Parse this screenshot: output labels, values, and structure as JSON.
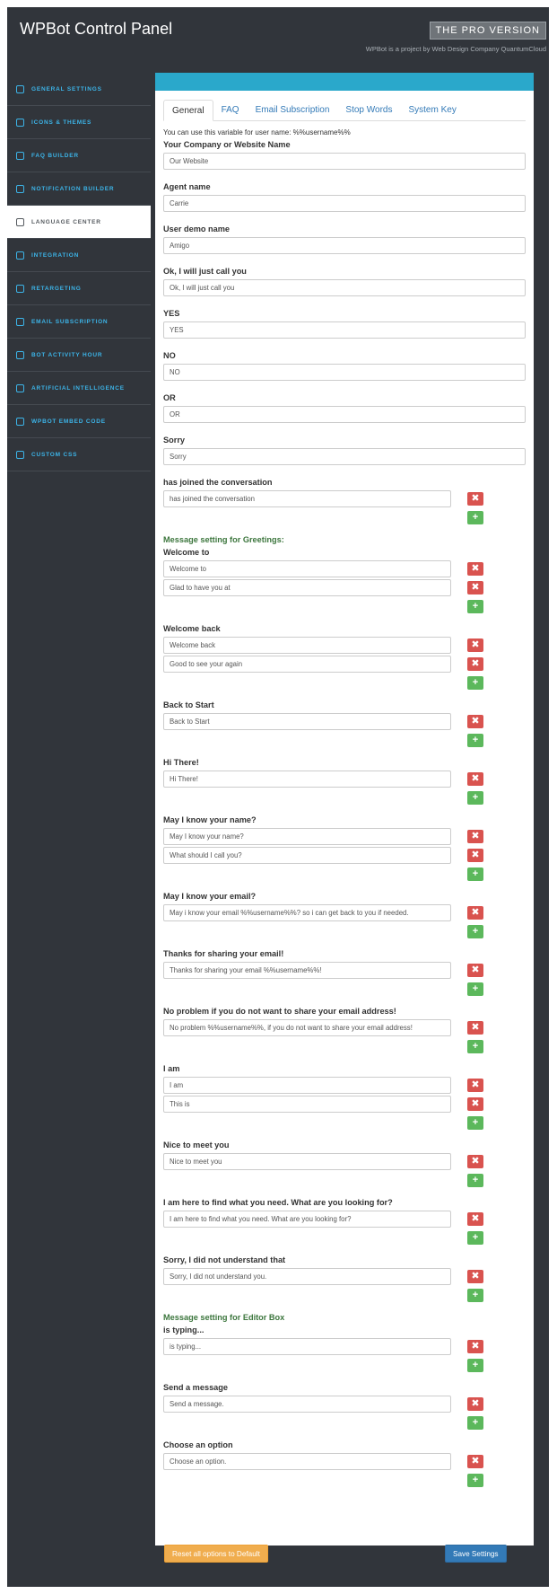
{
  "header": {
    "title": "WPBot Control Panel",
    "pro_badge": "THE PRO VERSION",
    "subtitle": "WPBot is a project by Web Design Company QuantumCloud"
  },
  "sidebar": {
    "items": [
      {
        "label": "GENERAL SETTINGS",
        "icon": "toggle-icon"
      },
      {
        "label": "ICONS & THEMES",
        "icon": "gear-icon"
      },
      {
        "label": "FAQ BUILDER",
        "icon": "lifebuoy-icon"
      },
      {
        "label": "NOTIFICATION BUILDER",
        "icon": "bell-icon"
      },
      {
        "label": "LANGUAGE CENTER",
        "icon": "translate-icon",
        "active": true
      },
      {
        "label": "INTEGRATION",
        "icon": "share-icon"
      },
      {
        "label": "RETARGETING",
        "icon": "retweet-icon"
      },
      {
        "label": "EMAIL SUBSCRIPTION",
        "icon": "envelope-icon"
      },
      {
        "label": "BOT ACTIVITY HOUR",
        "icon": "calendar-icon"
      },
      {
        "label": "ARTIFICIAL INTELLIGENCE",
        "icon": "database-icon"
      },
      {
        "label": "WPBOT EMBED CODE",
        "icon": "mobile-icon"
      },
      {
        "label": "CUSTOM CSS",
        "icon": "code-icon"
      }
    ]
  },
  "tabs": [
    "General",
    "FAQ",
    "Email Subscription",
    "Stop Words",
    "System Key"
  ],
  "note": "You can use this variable for user name: %%username%%",
  "sections": {
    "greetings": "Message setting for Greetings:",
    "editor": "Message setting for Editor Box"
  },
  "fields": [
    {
      "label": "Your Company or Website Name",
      "values": [
        "Our Website"
      ]
    },
    {
      "label": "Agent name",
      "values": [
        "Carrie"
      ]
    },
    {
      "label": "User demo name",
      "values": [
        "Amigo"
      ]
    },
    {
      "label": "Ok, I will just call you",
      "values": [
        "Ok, I will just call you"
      ]
    },
    {
      "label": "YES",
      "values": [
        "YES"
      ]
    },
    {
      "label": "NO",
      "values": [
        "NO"
      ]
    },
    {
      "label": "OR",
      "values": [
        "OR"
      ]
    },
    {
      "label": "Sorry",
      "values": [
        "Sorry"
      ]
    },
    {
      "label": "has joined the conversation",
      "values": [
        "has joined the conversation"
      ]
    },
    {
      "label": "Welcome to",
      "values": [
        "Welcome to",
        "Glad to have you at"
      ]
    },
    {
      "label": "Welcome back",
      "values": [
        "Welcome back",
        "Good to see your again"
      ]
    },
    {
      "label": "Back to Start",
      "values": [
        "Back to Start"
      ]
    },
    {
      "label": "Hi There!",
      "values": [
        "Hi There!"
      ]
    },
    {
      "label": "May I know your name?",
      "values": [
        "May I know your name?",
        "What should I call you?"
      ]
    },
    {
      "label": "May I know your email?",
      "values": [
        "May i know your email %%username%%? so i can get back to you if needed."
      ]
    },
    {
      "label": "Thanks for sharing your email!",
      "values": [
        "Thanks for sharing your email %%username%%!"
      ]
    },
    {
      "label": "No problem if you do not want to share your email address!",
      "values": [
        "No problem %%username%%, if you do not want to share your email address!"
      ]
    },
    {
      "label": "I am",
      "values": [
        "I am",
        "This is"
      ]
    },
    {
      "label": "Nice to meet you",
      "values": [
        "Nice to meet you"
      ]
    },
    {
      "label": "I am here to find what you need. What are you looking for?",
      "values": [
        "I am here to find what you need. What are you looking for?"
      ]
    },
    {
      "label": "Sorry, I did not understand that",
      "values": [
        "Sorry, I did not understand you."
      ]
    },
    {
      "label": "is typing...",
      "values": [
        "is typing..."
      ]
    },
    {
      "label": "Send a message",
      "values": [
        "Send a message."
      ]
    },
    {
      "label": "Choose an option",
      "values": [
        "Choose an option."
      ]
    }
  ],
  "buttons": {
    "delete_symbol": "✖",
    "add_symbol": "+",
    "reset": "Reset all options to Default",
    "save": "Save Settings"
  }
}
